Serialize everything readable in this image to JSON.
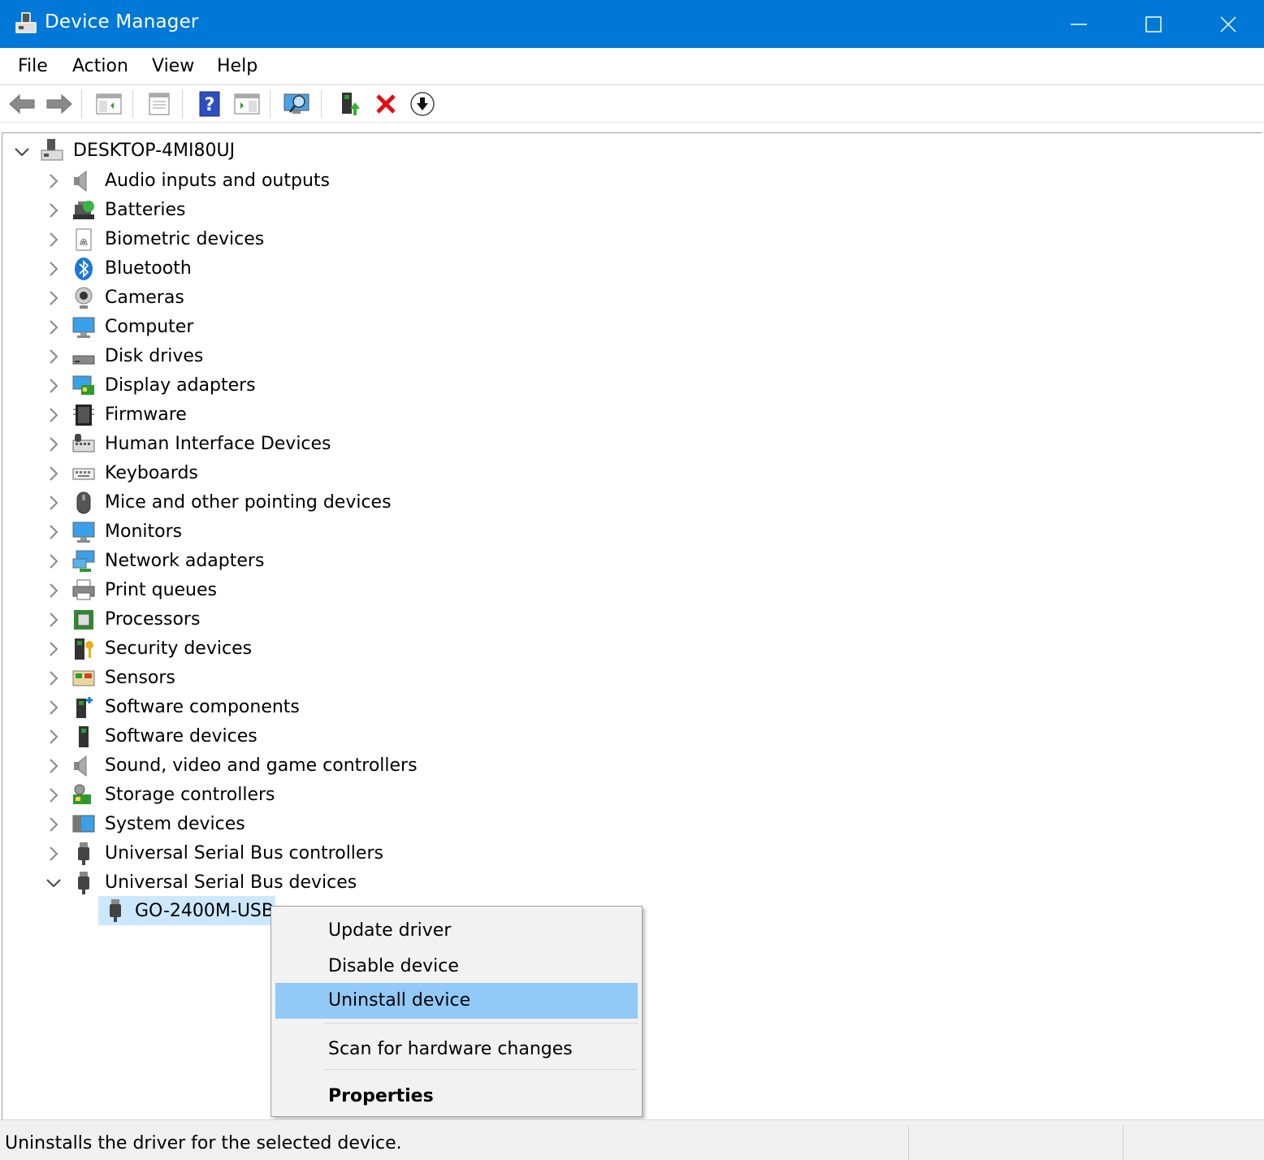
{
  "window": {
    "title": "Device Manager",
    "controls": {
      "minimize": "minimize",
      "maximize": "maximize",
      "close": "close"
    },
    "accent_color": "#0078d7"
  },
  "menu": [
    "File",
    "Action",
    "View",
    "Help"
  ],
  "toolbar": {
    "buttons": [
      "back-arrow-icon",
      "forward-arrow-icon",
      "show-hide-console-tree-icon",
      "properties-icon",
      "help-icon",
      "action-pane-icon",
      "scan-hardware-icon",
      "update-driver-icon",
      "uninstall-icon",
      "disable-device-icon"
    ]
  },
  "tree": {
    "root": "DESKTOP-4MI80UJ",
    "categories": [
      "Audio inputs and outputs",
      "Batteries",
      "Biometric devices",
      "Bluetooth",
      "Cameras",
      "Computer",
      "Disk drives",
      "Display adapters",
      "Firmware",
      "Human Interface Devices",
      "Keyboards",
      "Mice and other pointing devices",
      "Monitors",
      "Network adapters",
      "Print queues",
      "Processors",
      "Security devices",
      "Sensors",
      "Software components",
      "Software devices",
      "Sound, video and game controllers",
      "Storage controllers",
      "System devices",
      "Universal Serial Bus controllers",
      "Universal Serial Bus devices"
    ],
    "expanded_category": "Universal Serial Bus devices",
    "selected_device": "GO-2400M-USB"
  },
  "context_menu": {
    "items": [
      "Update driver",
      "Disable device",
      "Uninstall device",
      "Scan for hardware changes",
      "Properties"
    ],
    "highlighted": "Uninstall device",
    "highlight_color": "#91c9f7"
  },
  "status": {
    "message": "Uninstalls the driver for the selected device."
  }
}
